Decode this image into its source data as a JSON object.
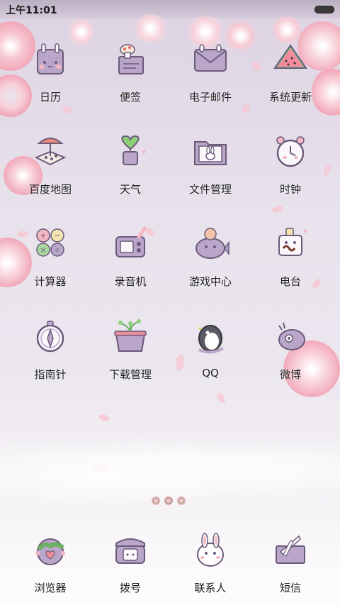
{
  "status_bar": {
    "time": "上午11:01"
  },
  "apps": [
    {
      "label": "日历",
      "icon": "calendar-icon"
    },
    {
      "label": "便签",
      "icon": "notes-icon"
    },
    {
      "label": "电子邮件",
      "icon": "email-icon"
    },
    {
      "label": "系统更新",
      "icon": "system-update-icon"
    },
    {
      "label": "百度地图",
      "icon": "map-icon"
    },
    {
      "label": "天气",
      "icon": "weather-icon"
    },
    {
      "label": "文件管理",
      "icon": "folder-icon"
    },
    {
      "label": "时钟",
      "icon": "clock-icon"
    },
    {
      "label": "计算器",
      "icon": "calculator-icon"
    },
    {
      "label": "录音机",
      "icon": "recorder-icon"
    },
    {
      "label": "游戏中心",
      "icon": "game-center-icon"
    },
    {
      "label": "电台",
      "icon": "radio-icon"
    },
    {
      "label": "指南针",
      "icon": "compass-icon"
    },
    {
      "label": "下载管理",
      "icon": "download-icon"
    },
    {
      "label": "QQ",
      "icon": "qq-icon"
    },
    {
      "label": "微博",
      "icon": "weibo-icon"
    }
  ],
  "dock": [
    {
      "label": "浏览器",
      "icon": "browser-icon"
    },
    {
      "label": "拨号",
      "icon": "phone-icon"
    },
    {
      "label": "联系人",
      "icon": "contacts-icon"
    },
    {
      "label": "短信",
      "icon": "messages-icon"
    }
  ],
  "colors": {
    "icon_purple": "#b9a6c9",
    "icon_outline": "#6b5a7a",
    "petal_pink": "#f4b7c4"
  }
}
